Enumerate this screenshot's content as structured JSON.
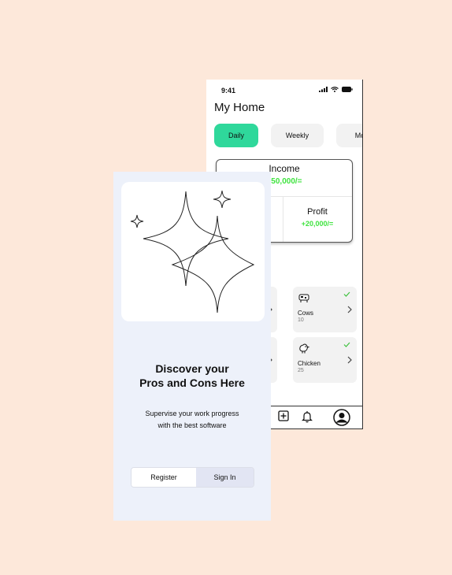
{
  "home": {
    "status": {
      "time": "9:41"
    },
    "title": "My Home",
    "tabs": [
      {
        "label": "Daily",
        "active": true
      },
      {
        "label": "Weekly",
        "active": false
      },
      {
        "label": "Mo",
        "active": false
      }
    ],
    "stats": {
      "income_label": "Income",
      "income_value": "+50,000/=",
      "profit_label": "Profit",
      "profit_value": "+20,000/="
    },
    "animals": [
      {
        "name": "Cows",
        "count": "10",
        "icon": "cow-icon",
        "checked": true
      },
      {
        "name": "Chicken",
        "count": "25",
        "icon": "chicken-icon",
        "checked": true
      }
    ],
    "nav": [
      "add-icon",
      "bell-icon",
      "profile-icon"
    ]
  },
  "onboarding": {
    "title_line1": "Discover your",
    "title_line2": "Pros and Cons Here",
    "subtitle_line1": "Supervise your work progress",
    "subtitle_line2": "with the best software",
    "register_label": "Register",
    "signin_label": "Sign In"
  },
  "colors": {
    "background": "#FDE8DA",
    "accent_green": "#2FD89B",
    "value_green": "#3EE33E",
    "onboarding_bg": "#EDF1FA",
    "signin_bg": "#E2E5F3"
  }
}
